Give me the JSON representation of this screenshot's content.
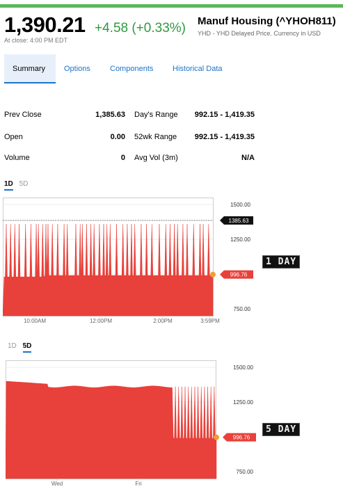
{
  "quote": {
    "price": "1,390.21",
    "change": "+4.58 (+0.33%)",
    "close_note": "At close: 4:00 PM EDT",
    "name": "Manuf Housing (^YHOH811)",
    "subname": "YHD - YHD Delayed Price. Currency in USD"
  },
  "colors": {
    "up": "#2e9a3f",
    "accent": "#1a73c8",
    "chart_fill": "#e8403a",
    "top_bar": "#5cb85c"
  },
  "tabs": [
    {
      "label": "Summary",
      "active": true
    },
    {
      "label": "Options",
      "active": false
    },
    {
      "label": "Components",
      "active": false
    },
    {
      "label": "Historical Data",
      "active": false
    }
  ],
  "stats": [
    {
      "label": "Prev Close",
      "value": "1,385.63",
      "label2": "Day's Range",
      "value2": "992.15 - 1,419.35"
    },
    {
      "label": "Open",
      "value": "0.00",
      "label2": "52wk Range",
      "value2": "992.15 - 1,419.35"
    },
    {
      "label": "Volume",
      "value": "0",
      "label2": "Avg Vol (3m)",
      "value2": "N/A"
    }
  ],
  "chart1": {
    "range_selector": [
      "1D",
      "5D"
    ],
    "selected": "1D",
    "side_tag": "1 DAY"
  },
  "chart2": {
    "range_selector": [
      "1D",
      "5D"
    ],
    "selected": "5D",
    "side_tag": "5 DAY"
  },
  "chart_data": [
    {
      "type": "area",
      "title": "",
      "xticks": [
        "10:00AM",
        "12:00PM",
        "2:00PM",
        "3:59PM"
      ],
      "yticks": [
        "1500.00",
        "1250.00",
        "1000.00",
        "750.00"
      ],
      "ylim": [
        750,
        1500
      ],
      "prev_close": 1385.63,
      "prev_close_label": "1385.63",
      "last": 996.76,
      "last_label": "996.76",
      "baseline": 990,
      "spike_high": 1360,
      "spike_count": 44,
      "grid": true
    },
    {
      "type": "area",
      "title": "",
      "xticks": [
        "Wed",
        "Fri"
      ],
      "yticks": [
        "1500.00",
        "1250.00",
        "1000.00",
        "750.00"
      ],
      "ylim": [
        750,
        1500
      ],
      "last": 996.76,
      "last_label": "996.76",
      "level_start": 1400,
      "level_end": 1360,
      "drop_level": 990,
      "spike_count": 18,
      "grid": true
    }
  ]
}
